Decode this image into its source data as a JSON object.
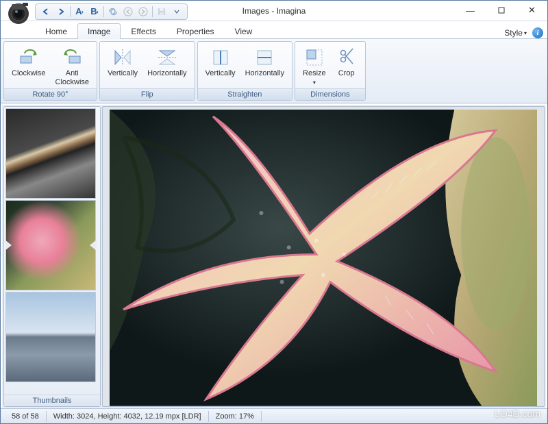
{
  "window": {
    "title": "Images - Imagina"
  },
  "qat": {
    "prev_label": "A",
    "next_label": "B"
  },
  "tabs": {
    "items": [
      {
        "label": "Home"
      },
      {
        "label": "Image"
      },
      {
        "label": "Effects"
      },
      {
        "label": "Properties"
      },
      {
        "label": "View"
      }
    ],
    "active_index": 1,
    "style_label": "Style"
  },
  "ribbon": {
    "groups": [
      {
        "label": "Rotate 90°",
        "buttons": [
          {
            "name": "rotate-clockwise",
            "label": "Clockwise"
          },
          {
            "name": "rotate-anticlockwise",
            "label": "Anti\nClockwise"
          }
        ]
      },
      {
        "label": "Flip",
        "buttons": [
          {
            "name": "flip-vertically",
            "label": "Vertically"
          },
          {
            "name": "flip-horizontally",
            "label": "Horizontally"
          }
        ]
      },
      {
        "label": "Straighten",
        "buttons": [
          {
            "name": "straighten-vertically",
            "label": "Vertically"
          },
          {
            "name": "straighten-horizontally",
            "label": "Horizontally"
          }
        ]
      },
      {
        "label": "Dimensions",
        "buttons": [
          {
            "name": "resize",
            "label": "Resize"
          },
          {
            "name": "crop",
            "label": "Crop"
          }
        ]
      }
    ]
  },
  "thumbnails": {
    "footer": "Thumbnails",
    "items": [
      {
        "name": "cat-thumb"
      },
      {
        "name": "starfish-thumb"
      },
      {
        "name": "building-thumb"
      }
    ],
    "selected_index": 1
  },
  "status": {
    "position": "58 of 58",
    "dimensions": "Width: 3024, Height: 4032, 12.19 mpx [LDR]",
    "zoom": "Zoom: 17%"
  },
  "watermark": "LO4D.com"
}
